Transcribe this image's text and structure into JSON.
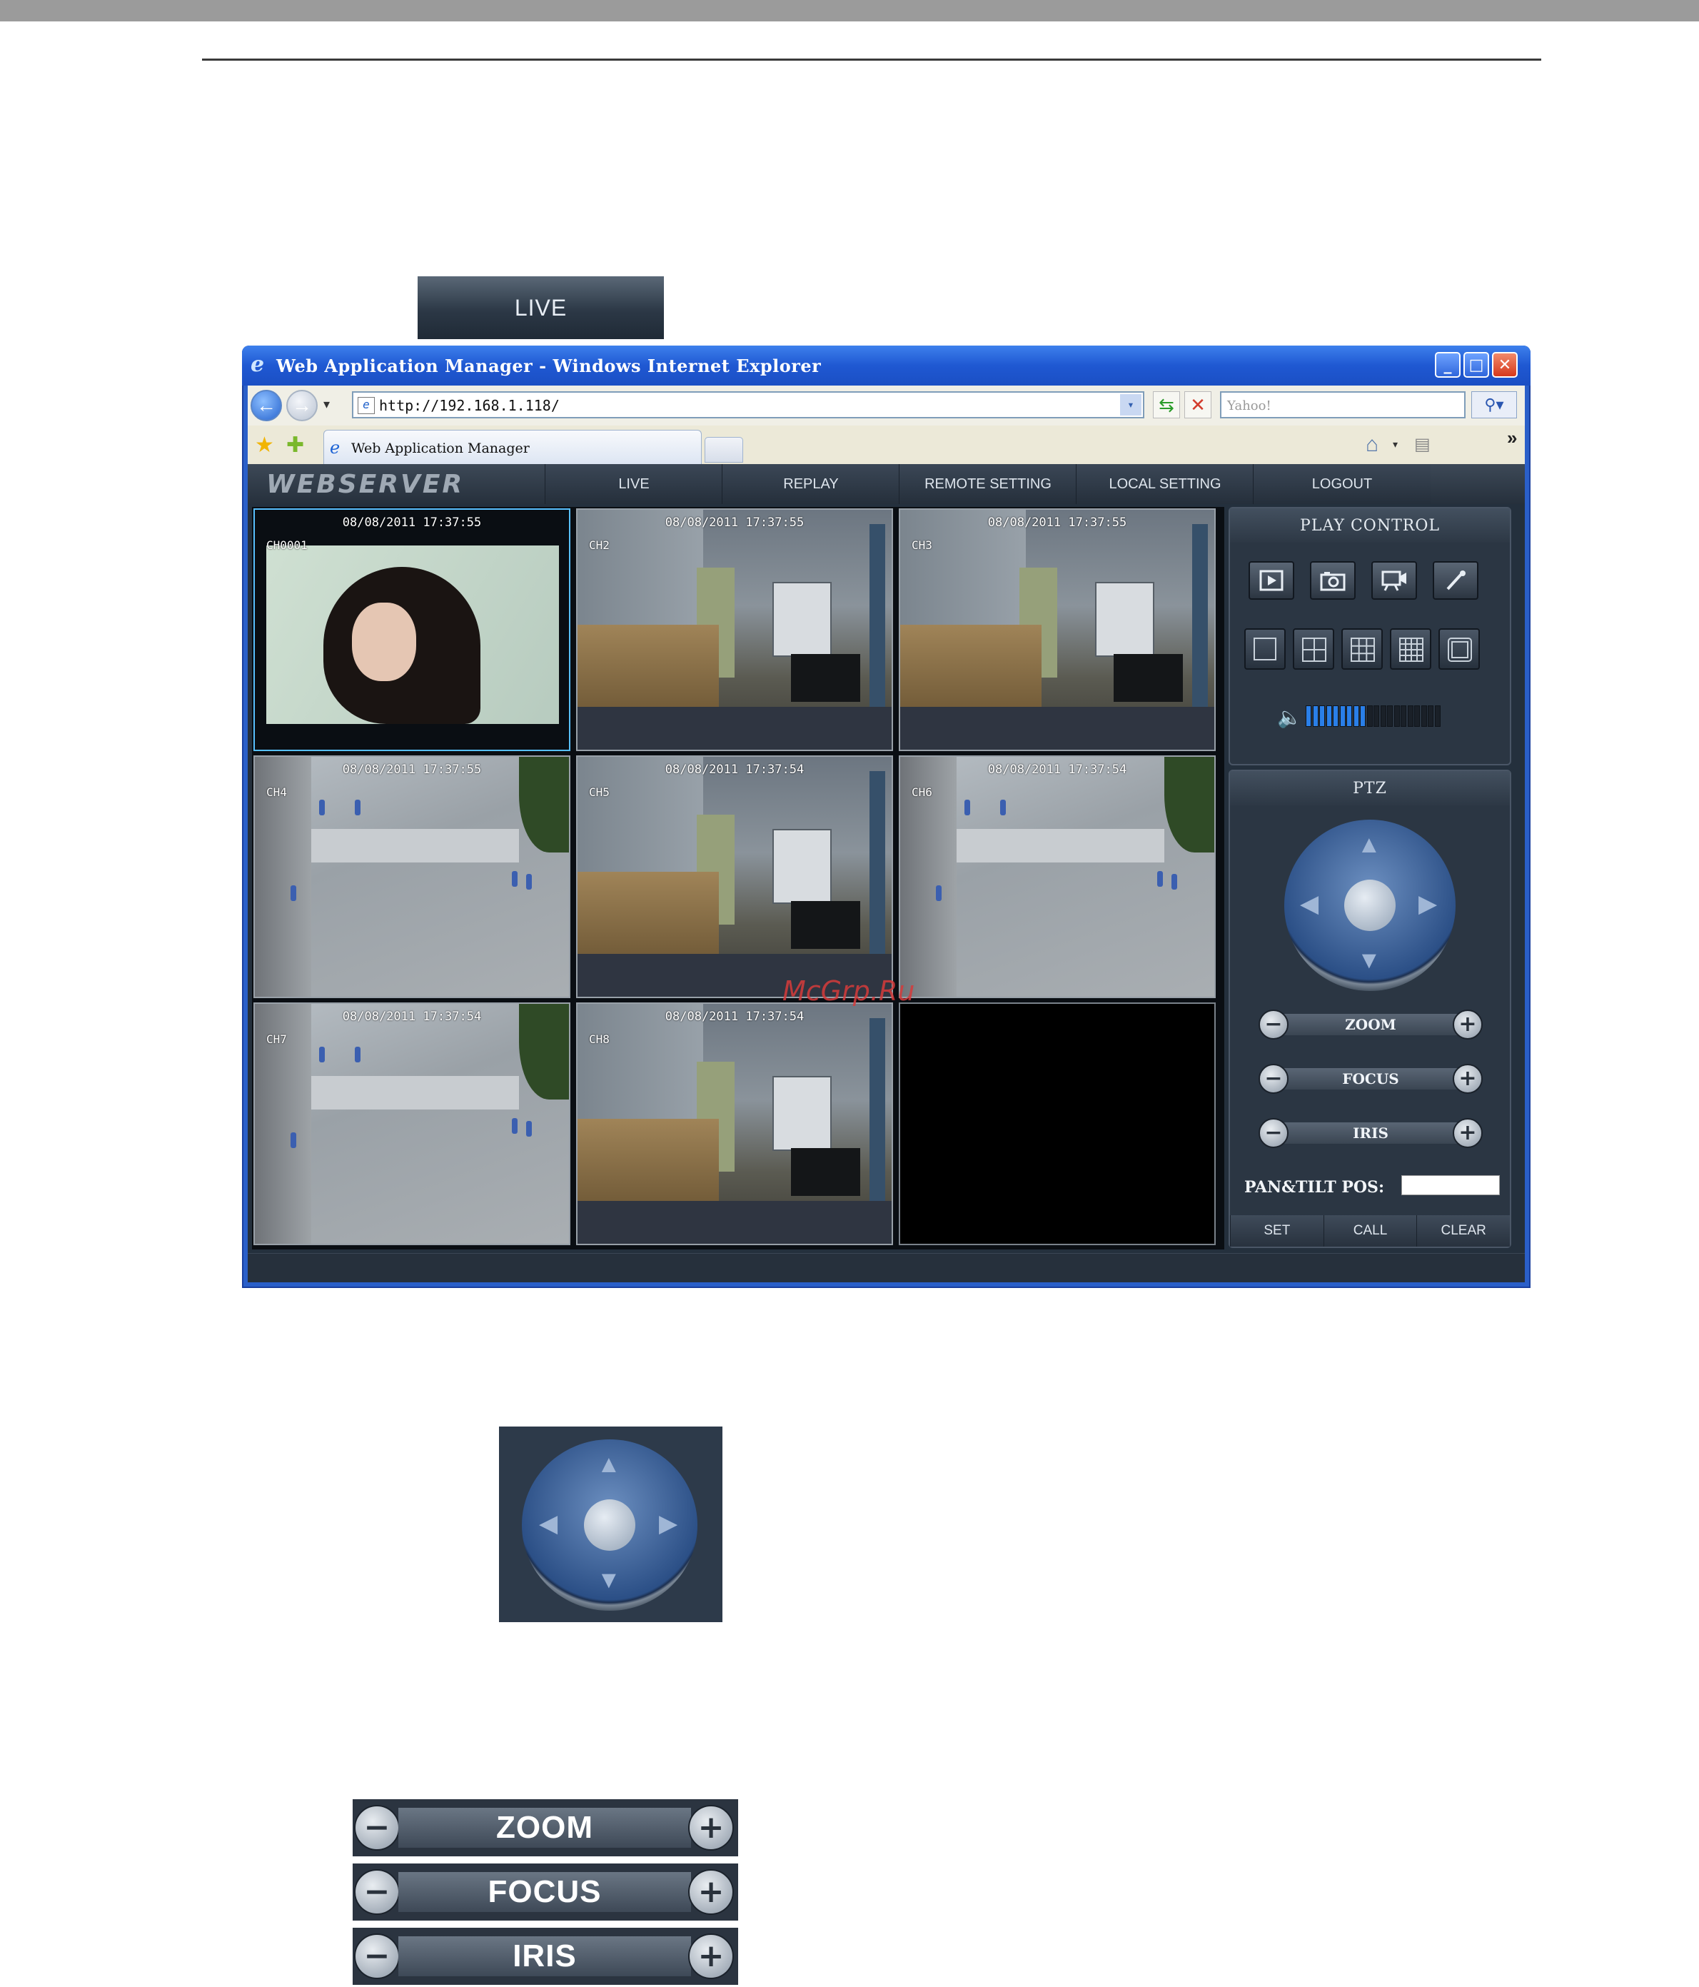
{
  "callouts": {
    "live_tab_label": "LIVE",
    "zoom_label": "ZOOM",
    "focus_label": "FOCUS",
    "iris_label": "IRIS"
  },
  "browser": {
    "window_title": "Web Application Manager - Windows Internet Explorer",
    "address_url": "http://192.168.1.118/",
    "search_placeholder": "Yahoo!",
    "tab_title": "Web Application Manager",
    "more_tools": "»"
  },
  "app": {
    "logo_text": "WEBSERVER",
    "menu": [
      "LIVE",
      "REPLAY",
      "REMOTE SETTING",
      "LOCAL SETTING",
      "LOGOUT"
    ],
    "channels": [
      {
        "timestamp": "08/08/2011 17:37:55",
        "label": "CH0001",
        "scene": "girl"
      },
      {
        "timestamp": "08/08/2011 17:37:55",
        "label": "CH2",
        "scene": "office"
      },
      {
        "timestamp": "08/08/2011 17:37:55",
        "label": "CH3",
        "scene": "office"
      },
      {
        "timestamp": "08/08/2011 17:37:55",
        "label": "CH4",
        "scene": "yard"
      },
      {
        "timestamp": "08/08/2011 17:37:54",
        "label": "CH5",
        "scene": "office"
      },
      {
        "timestamp": "08/08/2011 17:37:54",
        "label": "CH6",
        "scene": "yard"
      },
      {
        "timestamp": "08/08/2011 17:37:54",
        "label": "CH7",
        "scene": "yard"
      },
      {
        "timestamp": "08/08/2011 17:37:54",
        "label": "CH8",
        "scene": "office"
      },
      {
        "timestamp": "",
        "label": "",
        "scene": "empty"
      }
    ],
    "play_control": {
      "title": "PLAY CONTROL",
      "volume_level": 0.45,
      "volume_segments": 20
    },
    "ptz": {
      "title": "PTZ",
      "zoom_label": "ZOOM",
      "focus_label": "FOCUS",
      "iris_label": "IRIS",
      "pos_label": "PAN&TILT POS:",
      "pos_value": "",
      "set_label": "SET",
      "call_label": "CALL",
      "clear_label": "CLEAR"
    }
  },
  "watermark": "McGrp.Ru",
  "colors": {
    "accent_blue": "#2a7fe8",
    "selected_border": "#58c0ff",
    "titlebar_blue": "#1f58d2",
    "panel_bg": "#2b3643"
  }
}
